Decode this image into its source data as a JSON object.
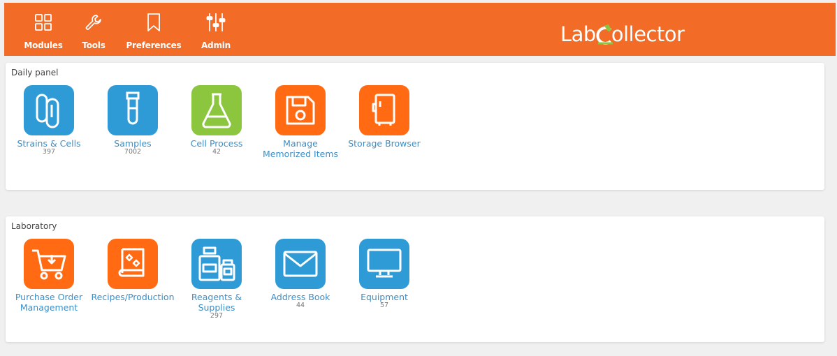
{
  "header": {
    "nav": [
      {
        "label": "Modules",
        "icon": "grid-icon"
      },
      {
        "label": "Tools",
        "icon": "wrench-icon"
      },
      {
        "label": "Preferences",
        "icon": "bookmark-icon"
      },
      {
        "label": "Admin",
        "icon": "sliders-icon"
      }
    ],
    "logo": {
      "part1": "Lab",
      "part2": "ollector"
    }
  },
  "daily_panel": {
    "title": "Daily panel",
    "tiles": [
      {
        "label": "Strains & Cells",
        "count": "397",
        "icon": "paperclip-icon",
        "color": "#2f9bd6"
      },
      {
        "label": "Samples",
        "count": "7002",
        "icon": "test-tube-icon",
        "color": "#2f9bd6"
      },
      {
        "label": "Cell Process",
        "count": "42",
        "icon": "flask-icon",
        "color": "#8cc63f"
      },
      {
        "label": "Manage Memorized Items",
        "count": "",
        "icon": "floppy-disk-icon",
        "color": "#ff6a13"
      },
      {
        "label": "Storage Browser",
        "count": "",
        "icon": "freezer-icon",
        "color": "#ff6a13"
      }
    ]
  },
  "laboratory": {
    "title": "Laboratory",
    "tiles": [
      {
        "label": "Purchase Order Management",
        "count": "",
        "icon": "shopping-cart-icon",
        "color": "#ff6a13"
      },
      {
        "label": "Recipes/Production",
        "count": "",
        "icon": "recipe-book-icon",
        "color": "#ff6a13"
      },
      {
        "label": "Reagents & Supplies",
        "count": "297",
        "icon": "bottles-icon",
        "color": "#2f9bd6"
      },
      {
        "label": "Address Book",
        "count": "44",
        "icon": "envelope-icon",
        "color": "#2f9bd6"
      },
      {
        "label": "Equipment",
        "count": "57",
        "icon": "monitor-icon",
        "color": "#2f9bd6"
      }
    ]
  }
}
